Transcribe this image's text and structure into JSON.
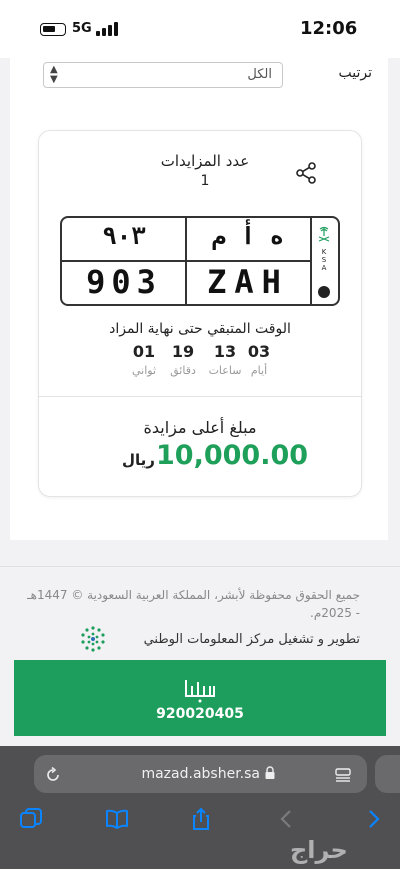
{
  "status_bar": {
    "network": "5G",
    "time": "12:06"
  },
  "sort": {
    "label": "ترتيب",
    "selected": "الكل"
  },
  "auction_card": {
    "bids_title": "عدد المزايدات",
    "bids_count": "1",
    "plate": {
      "arabic_numbers": "٩٠٣",
      "arabic_letters": "ه أ م",
      "english_numbers": "903",
      "english_letters": "ZAH",
      "country_code": "KSA"
    },
    "time_left_title": "الوقت المتبقي حتى نهاية المزاد",
    "countdown": [
      {
        "value": "03",
        "unit": "أيام"
      },
      {
        "value": "13",
        "unit": "ساعات"
      },
      {
        "value": "19",
        "unit": "دقائق"
      },
      {
        "value": "01",
        "unit": "ثواني"
      }
    ],
    "highest_bid_title": "مبلغ أعلى مزايدة",
    "highest_bid_amount": "10,000.00",
    "currency": "ريال"
  },
  "footer": {
    "copyright": "جميع الحقوق محفوظة لأبشر، المملكة العربية السعودية © 1447هـ - 2025م.",
    "developed_by": "تطوير و تشغيل مركز المعلومات الوطني",
    "banner_phone": "920020405",
    "banner_logo_text": "أبشر"
  },
  "browser": {
    "url": "mazad.absher.sa"
  },
  "watermark": "حراج",
  "colors": {
    "accent_green": "#1e9e5c",
    "amount_green": "#1fa05a",
    "browser_bg": "#505053",
    "link_blue": "#0a84ff"
  }
}
